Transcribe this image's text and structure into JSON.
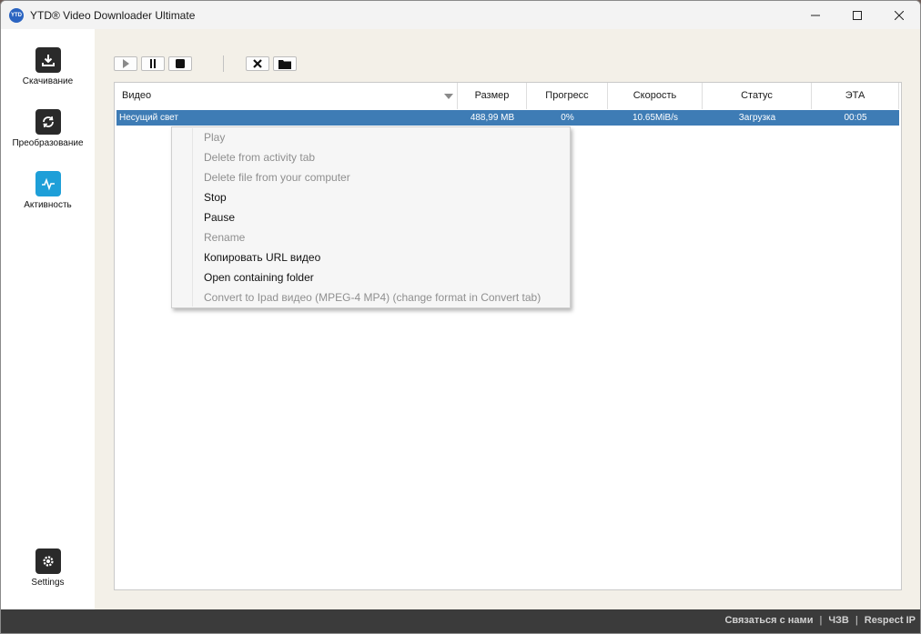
{
  "window": {
    "title": "YTD® Video Downloader Ultimate",
    "logo_text": "YTD"
  },
  "sidebar": {
    "items": [
      {
        "label": "Скачивание",
        "icon": "download-icon"
      },
      {
        "label": "Преобразование",
        "icon": "convert-icon"
      },
      {
        "label": "Активность",
        "icon": "activity-icon",
        "active": true
      }
    ],
    "settings_label": "Settings"
  },
  "toolbar": {
    "buttons": [
      "play-icon",
      "pause-icon",
      "stop-icon",
      "delete-icon",
      "folder-icon"
    ]
  },
  "grid": {
    "columns": [
      "Видео",
      "Размер",
      "Прогресс",
      "Скорость",
      "Статус",
      "ЭТА"
    ],
    "rows": [
      {
        "video": "Несущий свет",
        "size": "488,99 MB",
        "progress": "0%",
        "speed": "10.65MiB/s",
        "status": "Загрузка",
        "eta": "00:05"
      }
    ]
  },
  "context_menu": {
    "items": [
      {
        "label": "Play",
        "enabled": false
      },
      {
        "label": "Delete from activity tab",
        "enabled": false
      },
      {
        "label": "Delete file from your computer",
        "enabled": false
      },
      {
        "label": "Stop",
        "enabled": true
      },
      {
        "label": "Pause",
        "enabled": true
      },
      {
        "label": "Rename",
        "enabled": false
      },
      {
        "label": "Копировать URL видео",
        "enabled": true
      },
      {
        "label": "Open containing folder",
        "enabled": true
      },
      {
        "label": "Convert to Ipad видео (MPEG-4 MP4) (change format in Convert tab)",
        "enabled": false
      }
    ]
  },
  "footer": {
    "links": [
      "Связаться с нами",
      "ЧЗВ",
      "Respect IP"
    ],
    "separator": "|"
  },
  "colors": {
    "selection": "#3e7cb5",
    "active_nav": "#1e9fd8",
    "footer_bg": "#3b3b3b"
  }
}
